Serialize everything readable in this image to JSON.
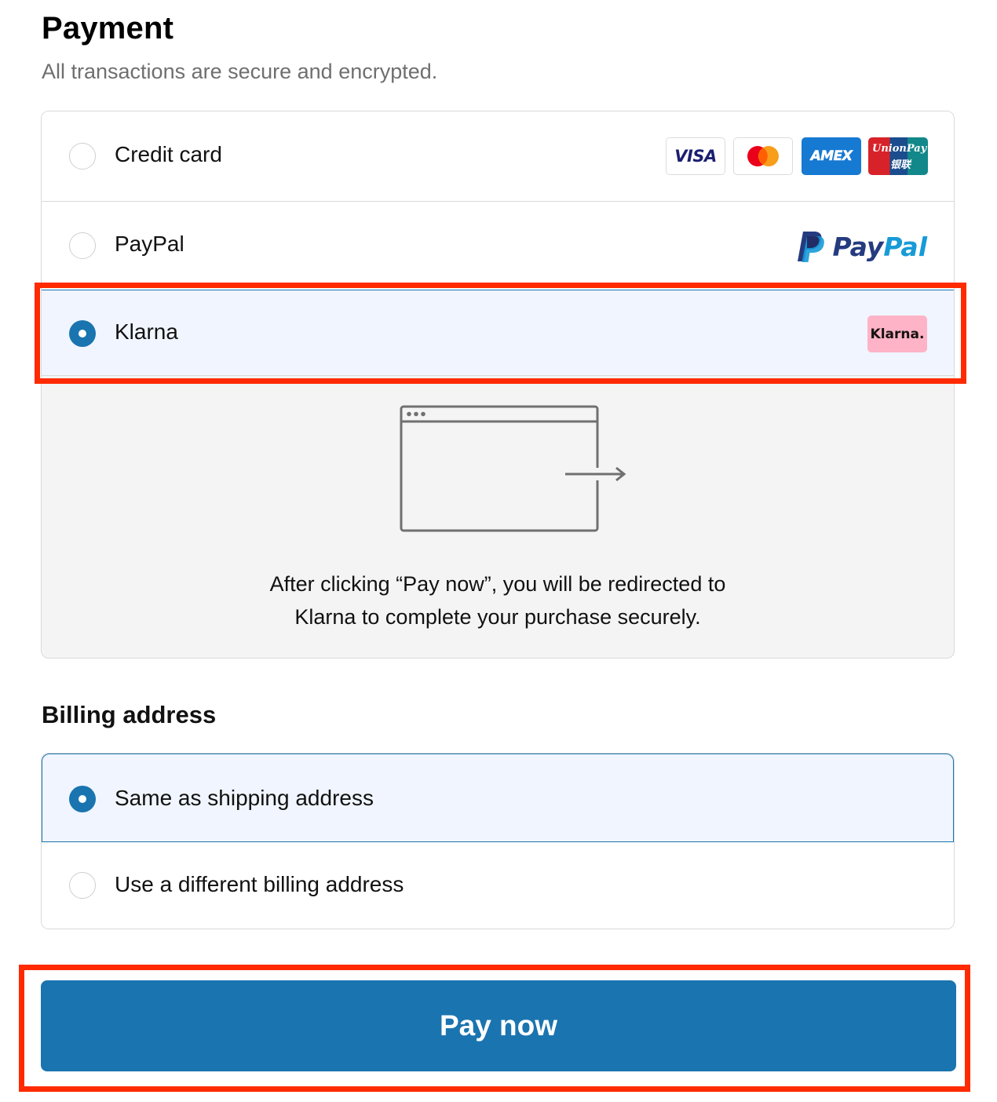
{
  "payment": {
    "title": "Payment",
    "subtitle": "All transactions are secure and encrypted.",
    "options": [
      {
        "label": "Credit card",
        "selected": false,
        "badges": [
          "visa-icon",
          "mastercard-icon",
          "amex-icon",
          "unionpay-icon"
        ]
      },
      {
        "label": "PayPal",
        "selected": false,
        "logo": "paypal-logo"
      },
      {
        "label": "Klarna",
        "selected": true,
        "logo": "klarna-badge"
      }
    ],
    "card_badges": {
      "visa": "VISA",
      "amex": "AMEX",
      "unionpay_latin": "UnionPay",
      "unionpay_cn": "银联"
    },
    "paypal_logo": {
      "part1": "Pay",
      "part2": "Pal"
    },
    "klarna_logo": "Klarna.",
    "redirect_text_line1": "After clicking “Pay now”, you will be redirected to",
    "redirect_text_line2": "Klarna to complete your purchase securely."
  },
  "billing": {
    "title": "Billing address",
    "options": [
      {
        "label": "Same as shipping address",
        "selected": true
      },
      {
        "label": "Use a different billing address",
        "selected": false
      }
    ]
  },
  "pay_button": {
    "label": "Pay now"
  },
  "colors": {
    "accent": "#1a74b0",
    "selected_bg": "#f0f5ff",
    "highlight_frame": "#ff2a00"
  }
}
